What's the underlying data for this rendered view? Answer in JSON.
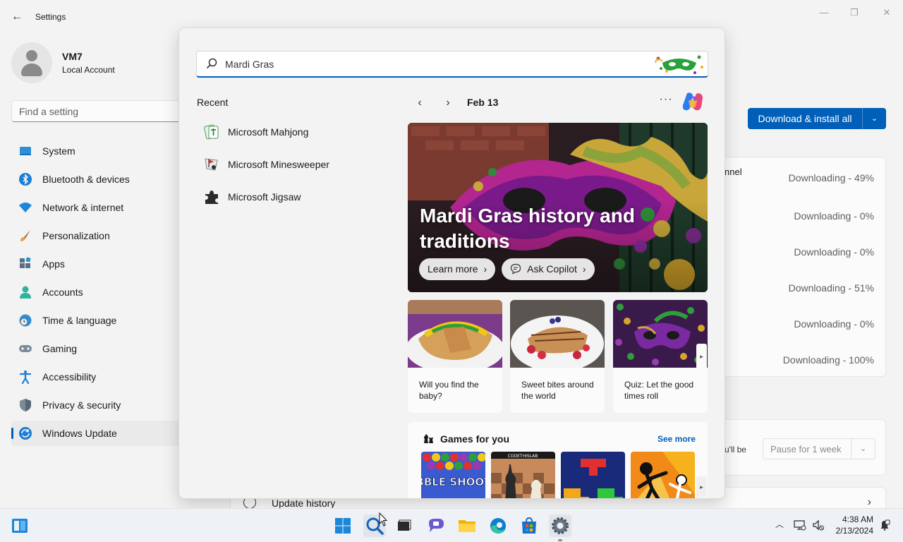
{
  "window": {
    "title": "Settings",
    "back_glyph": "←",
    "minimize": "—",
    "maximize": "❐",
    "close": "✕"
  },
  "profile": {
    "name": "VM7",
    "type": "Local Account"
  },
  "search_setting": {
    "placeholder": "Find a setting"
  },
  "sidebar": {
    "items": [
      {
        "label": "System",
        "icon": "system-icon"
      },
      {
        "label": "Bluetooth & devices",
        "icon": "bluetooth-icon"
      },
      {
        "label": "Network & internet",
        "icon": "wifi-icon"
      },
      {
        "label": "Personalization",
        "icon": "brush-icon"
      },
      {
        "label": "Apps",
        "icon": "apps-icon"
      },
      {
        "label": "Accounts",
        "icon": "accounts-icon"
      },
      {
        "label": "Time & language",
        "icon": "globe-clock-icon"
      },
      {
        "label": "Gaming",
        "icon": "controller-icon"
      },
      {
        "label": "Accessibility",
        "icon": "accessibility-icon"
      },
      {
        "label": "Privacy & security",
        "icon": "shield-icon"
      },
      {
        "label": "Windows Update",
        "icon": "sync-icon",
        "active": true
      }
    ]
  },
  "update": {
    "download_all": "Download & install all",
    "caret": "⌄",
    "partial_text_1": "nnel",
    "partial_text_2": ")",
    "statuses": [
      "Downloading - 49%",
      "Downloading - 0%",
      "Downloading - 0%",
      "Downloading - 51%",
      "Downloading - 0%",
      "Downloading - 100%"
    ],
    "pause_fragment": "u'll be",
    "pause_value": "Pause for 1 week",
    "history_label": "Update history",
    "history_chevron": "›"
  },
  "flyout": {
    "search_value": "Mardi Gras",
    "recent_title": "Recent",
    "recent": [
      {
        "label": "Microsoft Mahjong",
        "icon": "mahjong-icon"
      },
      {
        "label": "Microsoft Minesweeper",
        "icon": "minesweeper-icon"
      },
      {
        "label": "Microsoft Jigsaw",
        "icon": "jigsaw-icon"
      }
    ],
    "prev_glyph": "‹",
    "next_glyph": "›",
    "date": "Feb 13",
    "more_glyph": "···",
    "hero": {
      "title": "Mardi Gras history and traditions",
      "learn_more": "Learn more",
      "ask_copilot": "Ask Copilot",
      "chevron": "›"
    },
    "cards": [
      {
        "text": "Will you find the baby?"
      },
      {
        "text": "Sweet bites around the world"
      },
      {
        "text": "Quiz: Let the good times roll"
      }
    ],
    "scroll_glyph": "▸",
    "games": {
      "title": "Games for you",
      "see_more": "See more",
      "tile_text": [
        "BUBBLE SHOOTER",
        "CODETHISLAB"
      ]
    }
  },
  "taskbar": {
    "tray_chevron": "︿",
    "time": "4:38 AM",
    "date": "2/13/2024"
  },
  "colors": {
    "accent": "#005fb8",
    "background": "#f3f3f3"
  }
}
